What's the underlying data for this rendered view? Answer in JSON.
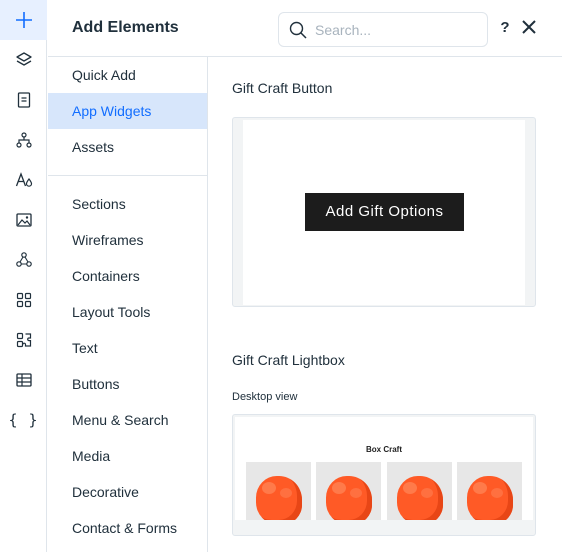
{
  "panel": {
    "title": "Add Elements",
    "help_label": "?"
  },
  "search": {
    "placeholder": "Search..."
  },
  "rail": {
    "items": [
      {
        "icon": "plus-icon",
        "active": true
      },
      {
        "icon": "layers-icon",
        "active": false
      },
      {
        "icon": "page-icon",
        "active": false
      },
      {
        "icon": "sitemap-icon",
        "active": false
      },
      {
        "icon": "theme-icon",
        "active": false
      },
      {
        "icon": "image-icon",
        "active": false
      },
      {
        "icon": "connections-icon",
        "active": false
      },
      {
        "icon": "apps-grid-icon",
        "active": false
      },
      {
        "icon": "puzzle-icon",
        "active": false
      },
      {
        "icon": "table-icon",
        "active": false
      },
      {
        "icon": "code-braces-icon",
        "active": false
      }
    ],
    "code_glyph": "{ }"
  },
  "categories": {
    "top": [
      {
        "label": "Quick Add",
        "selected": false
      },
      {
        "label": "App Widgets",
        "selected": true
      },
      {
        "label": "Assets",
        "selected": false
      }
    ],
    "bottom": [
      {
        "label": "Sections"
      },
      {
        "label": "Wireframes"
      },
      {
        "label": "Containers"
      },
      {
        "label": "Layout Tools"
      },
      {
        "label": "Text"
      },
      {
        "label": "Buttons"
      },
      {
        "label": "Menu & Search"
      },
      {
        "label": "Media"
      },
      {
        "label": "Decorative"
      },
      {
        "label": "Contact & Forms"
      }
    ]
  },
  "content": {
    "section1_title": "Gift Craft Button",
    "button_label": "Add Gift Options",
    "section2_title": "Gift Craft Lightbox",
    "desktop_view_label": "Desktop view",
    "lightbox_title": "Box Craft"
  },
  "colors": {
    "accent": "#116dff",
    "selected_bg": "#d7e6fb",
    "rail_active_bg": "#e7f0ff",
    "border": "#dfe5eb",
    "product_orange": "#ff5a26"
  }
}
